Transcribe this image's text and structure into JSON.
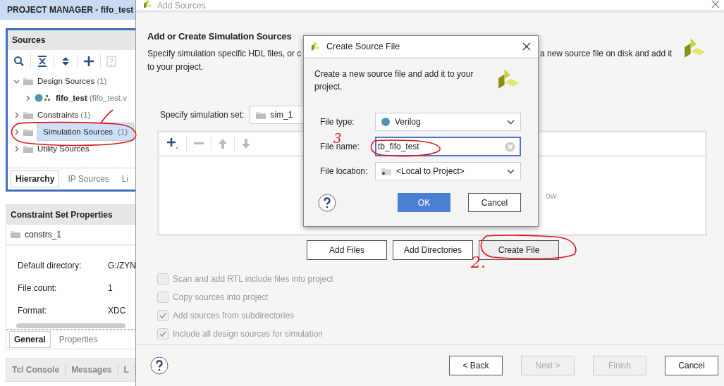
{
  "project_manager": {
    "title": "PROJECT MANAGER - fifo_test"
  },
  "sources": {
    "title": "Sources",
    "tree": [
      {
        "label": "Design Sources",
        "count": "(1)",
        "expanded": true,
        "selected": false,
        "children": [
          {
            "label": "fifo_test",
            "detail": "(fifo_test.v",
            "expanded": false,
            "selected": false
          }
        ]
      },
      {
        "label": "Constraints",
        "count": "(1)",
        "expanded": false,
        "selected": false
      },
      {
        "label": "Simulation Sources",
        "count": "(1)",
        "expanded": false,
        "selected": true
      },
      {
        "label": "Utility Sources",
        "expanded": false,
        "selected": false
      }
    ],
    "tabs": [
      {
        "label": "Hierarchy",
        "selected": true
      },
      {
        "label": "IP Sources",
        "selected": false
      },
      {
        "label": "Li",
        "selected": false
      }
    ]
  },
  "properties": {
    "title": "Constraint Set Properties",
    "item": "constrs_1",
    "rows": [
      {
        "label": "Default directory:",
        "value": "G:/ZYN"
      },
      {
        "label": "File count:",
        "value": "1"
      },
      {
        "label": "Format:",
        "value": "XDC"
      }
    ],
    "tabs": [
      {
        "label": "General",
        "selected": true
      },
      {
        "label": "Properties",
        "selected": false
      }
    ]
  },
  "console_tabs": [
    "Tcl Console",
    "Messages",
    "L"
  ],
  "add_sources": {
    "title": "Add Sources",
    "heading": "Add or Create Simulation Sources",
    "description_left": "Specify simulation specific HDL files, or c",
    "description_right": "a new source file on disk and add it",
    "description_line2": "to your project.",
    "sim_set_label": "Specify simulation set:",
    "sim_set": "sim_1",
    "list_hint": "ow",
    "buttons": [
      "Add Files",
      "Add Directories",
      "Create File"
    ],
    "options": [
      {
        "label": "Scan and add RTL include files into project",
        "checked": false,
        "disabled": true
      },
      {
        "label": "Copy sources into project",
        "checked": false,
        "disabled": true
      },
      {
        "label": "Add sources from subdirectories",
        "checked": true,
        "disabled": true
      },
      {
        "label": "Include all design sources for simulation",
        "checked": true,
        "disabled": true
      }
    ],
    "footer": [
      {
        "label": "< Back",
        "disabled": false
      },
      {
        "label": "Next >",
        "disabled": true
      },
      {
        "label": "Finish",
        "disabled": true
      },
      {
        "label": "Cancel",
        "disabled": false
      }
    ]
  },
  "create_file": {
    "title": "Create Source File",
    "description": "Create a new source file and add it to your project.",
    "file_type_label": "File type:",
    "file_type": "Verilog",
    "file_name_label": "File name:",
    "file_name": "tb_fifo_test",
    "file_location_label": "File location:",
    "file_location": "<Local to Project>",
    "ok": "OK",
    "cancel": "Cancel"
  },
  "annotations": [
    "2.",
    "3"
  ]
}
